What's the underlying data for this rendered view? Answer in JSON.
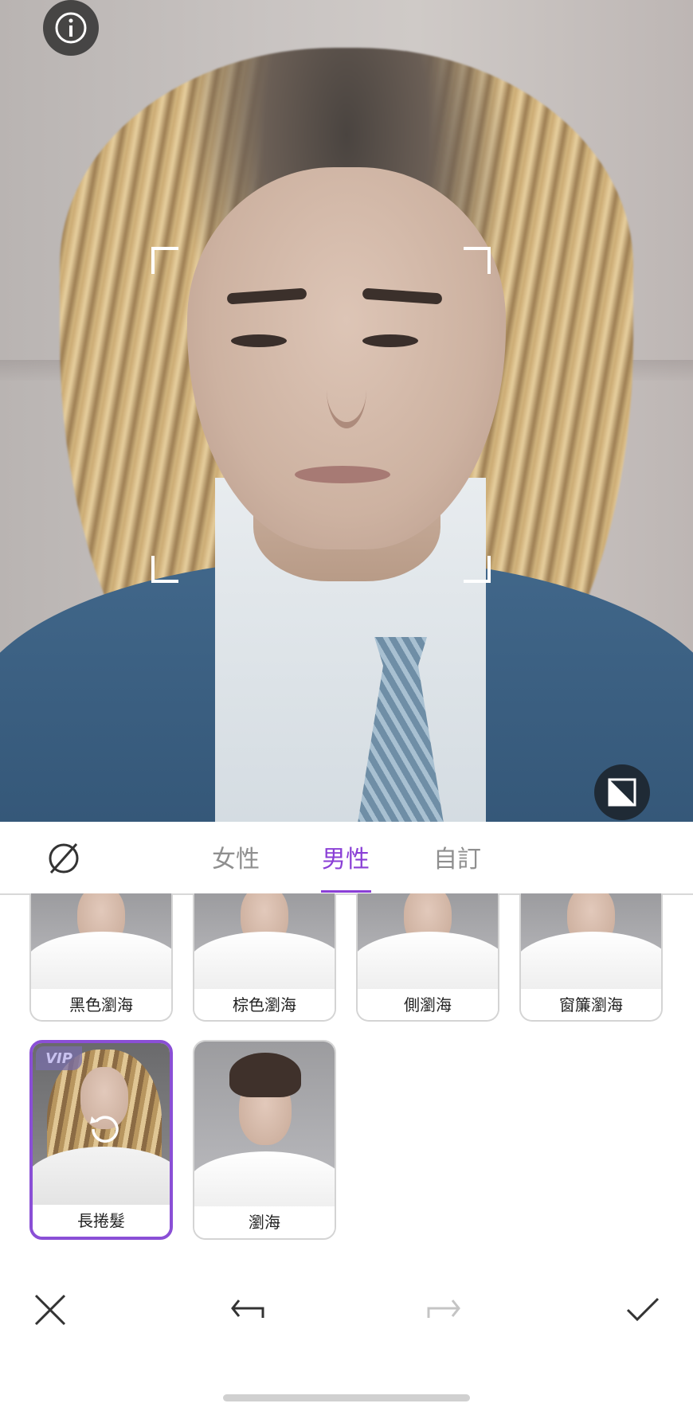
{
  "tabs": [
    {
      "label": "女性"
    },
    {
      "label": "男性"
    },
    {
      "label": "自訂"
    }
  ],
  "active_tab": "男性",
  "styles": [
    {
      "label": "黑色瀏海"
    },
    {
      "label": "棕色瀏海"
    },
    {
      "label": "側瀏海"
    },
    {
      "label": "窗簾瀏海"
    },
    {
      "label": "長捲髮",
      "badge": "VIP",
      "selected": true
    },
    {
      "label": "瀏海"
    }
  ],
  "accent_color": "#8a3fd6",
  "icons": {
    "info": "info-icon",
    "compare": "compare-icon",
    "none": "no-style-icon",
    "reset": "reset-icon",
    "close": "close-icon",
    "undo": "undo-icon",
    "redo": "redo-icon",
    "confirm": "check-icon"
  }
}
